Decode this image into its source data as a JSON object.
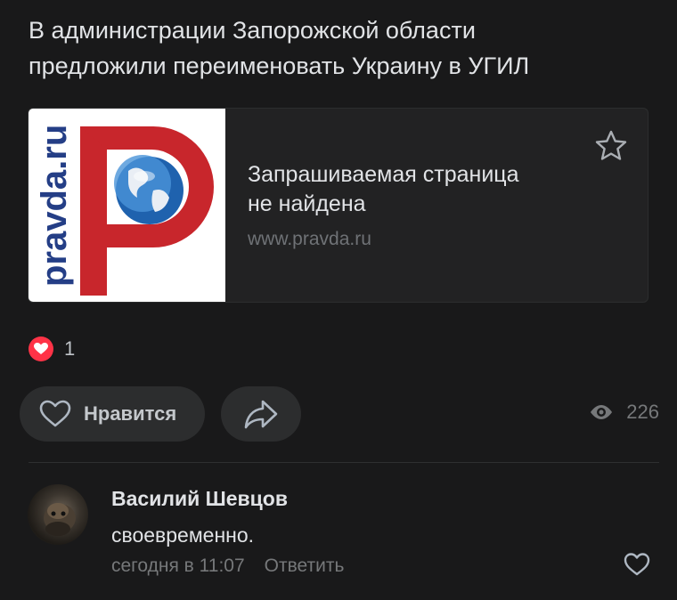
{
  "post": {
    "text": "В администрации Запорожской области\nпредложили переименовать Украину в УГИЛ"
  },
  "snippet": {
    "logo_text": "pravda.ru",
    "title": "Запрашиваемая страница\nне найдена",
    "domain": "www.pravda.ru",
    "fave_icon": "star-icon"
  },
  "reactions": {
    "count": "1",
    "color": "#ff3347"
  },
  "actions": {
    "like_label": "Нравится",
    "share_icon": "share-arrow-icon",
    "views": "226"
  },
  "comment": {
    "author": "Василий Шевцов",
    "text": "своевременно.",
    "time": "сегодня в 11:07",
    "reply_label": "Ответить"
  }
}
